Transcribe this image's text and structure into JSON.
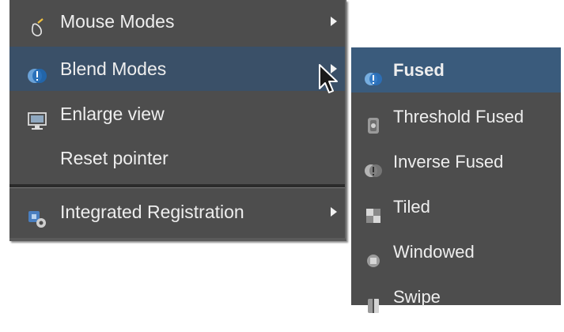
{
  "main_menu": {
    "items": [
      {
        "label": "Mouse Modes",
        "icon": "pointer-icon",
        "has_submenu": true
      },
      {
        "label": "Blend Modes",
        "icon": "blend-icon",
        "has_submenu": true,
        "highlighted": true
      },
      {
        "label": "Enlarge view",
        "icon": "monitor-icon",
        "has_submenu": false
      },
      {
        "label": "Reset pointer",
        "icon": "",
        "has_submenu": false
      },
      {
        "label": "Integrated Registration",
        "icon": "registration-icon",
        "has_submenu": true
      }
    ]
  },
  "submenu": {
    "items": [
      {
        "label": "Fused",
        "icon": "fused-icon",
        "selected": true
      },
      {
        "label": "Threshold Fused",
        "icon": "threshold-fused-icon"
      },
      {
        "label": "Inverse Fused",
        "icon": "inverse-fused-icon"
      },
      {
        "label": "Tiled",
        "icon": "tiled-icon"
      },
      {
        "label": "Windowed",
        "icon": "windowed-icon"
      },
      {
        "label": "Swipe",
        "icon": "swipe-icon"
      }
    ]
  },
  "colors": {
    "menu_bg": "#4d4d4d",
    "highlight": "#3a5068",
    "submenu_highlight": "#3a5b7c",
    "text": "#eeeeee"
  }
}
